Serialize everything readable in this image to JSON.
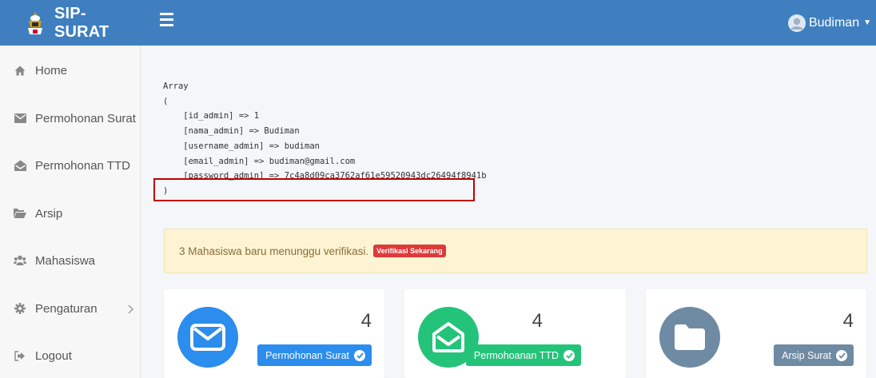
{
  "brand": {
    "name": "SIP-SURAT"
  },
  "user": {
    "name": "Budiman"
  },
  "sidebar": {
    "items": [
      {
        "label": "Home",
        "icon": "home-icon"
      },
      {
        "label": "Permohonan Surat",
        "icon": "envelope-icon"
      },
      {
        "label": "Permohonan TTD",
        "icon": "envelope-open-icon"
      },
      {
        "label": "Arsip",
        "icon": "folder-open-icon"
      },
      {
        "label": "Mahasiswa",
        "icon": "users-icon"
      },
      {
        "label": "Pengaturan",
        "icon": "gear-icon"
      },
      {
        "label": "Logout",
        "icon": "sign-out-icon"
      }
    ]
  },
  "dump": {
    "text": "Array\n(\n    [id_admin] => 1\n    [nama_admin] => Budiman\n    [username_admin] => budiman\n    [email_admin] => budiman@gmail.com\n    [password_admin] => 7c4a8d09ca3762af61e59520943dc26494f8941b\n)"
  },
  "alert": {
    "text": "3 Mahasiswa baru menunggu verifikasi.",
    "button": "Verifikasi Sekarang"
  },
  "cards": [
    {
      "count": "4",
      "label": "Permohonan Surat",
      "color": "#2b8ded"
    },
    {
      "count": "4",
      "label": "Permohoanan TTD",
      "color": "#24c37a"
    },
    {
      "count": "4",
      "label": "Arsip Surat",
      "color": "#6f8aa3"
    }
  ],
  "colors": {
    "header": "#3f7fbf",
    "highlight_border": "#c00000",
    "alert_bg": "#fcf4d2",
    "alert_button": "#dd3a3a"
  }
}
